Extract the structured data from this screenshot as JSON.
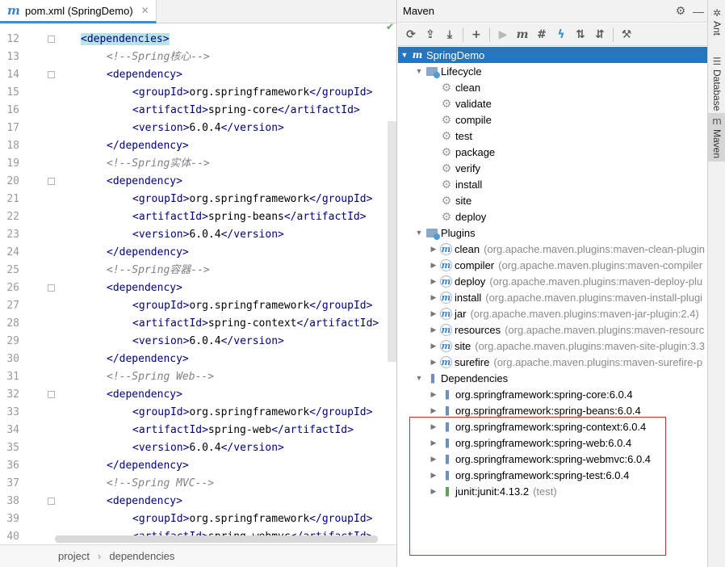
{
  "editor": {
    "tab_title": "pom.xml (SpringDemo)",
    "tab_icon": "m",
    "tab_close": "✕",
    "check_mark": "✔",
    "lines": [
      {
        "n": "12",
        "indent": 1,
        "kind": "tag",
        "text": "<dependencies>",
        "highlight": true
      },
      {
        "n": "13",
        "indent": 2,
        "kind": "comment",
        "text": "<!--Spring核心-->"
      },
      {
        "n": "14",
        "indent": 2,
        "kind": "tag",
        "text": "<dependency>"
      },
      {
        "n": "15",
        "indent": 3,
        "kind": "elem",
        "tag": "groupId",
        "value": "org.springframework"
      },
      {
        "n": "16",
        "indent": 3,
        "kind": "elem",
        "tag": "artifactId",
        "value": "spring-core"
      },
      {
        "n": "17",
        "indent": 3,
        "kind": "elem",
        "tag": "version",
        "value": "6.0.4"
      },
      {
        "n": "18",
        "indent": 2,
        "kind": "tag",
        "text": "</dependency>"
      },
      {
        "n": "19",
        "indent": 2,
        "kind": "comment",
        "text": "<!--Spring实体-->"
      },
      {
        "n": "20",
        "indent": 2,
        "kind": "tag",
        "text": "<dependency>"
      },
      {
        "n": "21",
        "indent": 3,
        "kind": "elem",
        "tag": "groupId",
        "value": "org.springframework"
      },
      {
        "n": "22",
        "indent": 3,
        "kind": "elem",
        "tag": "artifactId",
        "value": "spring-beans"
      },
      {
        "n": "23",
        "indent": 3,
        "kind": "elem",
        "tag": "version",
        "value": "6.0.4"
      },
      {
        "n": "24",
        "indent": 2,
        "kind": "tag",
        "text": "</dependency>"
      },
      {
        "n": "25",
        "indent": 2,
        "kind": "comment",
        "text": "<!--Spring容器-->"
      },
      {
        "n": "26",
        "indent": 2,
        "kind": "tag",
        "text": "<dependency>"
      },
      {
        "n": "27",
        "indent": 3,
        "kind": "elem",
        "tag": "groupId",
        "value": "org.springframework"
      },
      {
        "n": "28",
        "indent": 3,
        "kind": "elem",
        "tag": "artifactId",
        "value": "spring-context"
      },
      {
        "n": "29",
        "indent": 3,
        "kind": "elem",
        "tag": "version",
        "value": "6.0.4"
      },
      {
        "n": "30",
        "indent": 2,
        "kind": "tag",
        "text": "</dependency>"
      },
      {
        "n": "31",
        "indent": 2,
        "kind": "comment",
        "text": "<!--Spring Web-->"
      },
      {
        "n": "32",
        "indent": 2,
        "kind": "tag",
        "text": "<dependency>"
      },
      {
        "n": "33",
        "indent": 3,
        "kind": "elem",
        "tag": "groupId",
        "value": "org.springframework"
      },
      {
        "n": "34",
        "indent": 3,
        "kind": "elem",
        "tag": "artifactId",
        "value": "spring-web"
      },
      {
        "n": "35",
        "indent": 3,
        "kind": "elem",
        "tag": "version",
        "value": "6.0.4"
      },
      {
        "n": "36",
        "indent": 2,
        "kind": "tag",
        "text": "</dependency>"
      },
      {
        "n": "37",
        "indent": 2,
        "kind": "comment",
        "text": "<!--Spring MVC-->"
      },
      {
        "n": "38",
        "indent": 2,
        "kind": "tag",
        "text": "<dependency>"
      },
      {
        "n": "39",
        "indent": 3,
        "kind": "elem",
        "tag": "groupId",
        "value": "org.springframework"
      },
      {
        "n": "40",
        "indent": 3,
        "kind": "elem",
        "tag": "artifactId",
        "value": "spring-webmvc"
      }
    ],
    "breadcrumb": [
      "project",
      "dependencies"
    ],
    "breadcrumb_sep": "›"
  },
  "maven": {
    "title": "Maven",
    "header_icons": [
      "gear-icon",
      "minimize-icon"
    ],
    "header_glyphs": [
      "⚙",
      "—"
    ],
    "toolbar": [
      {
        "name": "reload-icon",
        "glyph": "⟳"
      },
      {
        "name": "reimport-folder-icon",
        "glyph": "⇪"
      },
      {
        "name": "download-icon",
        "glyph": "⤓"
      },
      {
        "name": "sep"
      },
      {
        "name": "add-icon",
        "glyph": "+"
      },
      {
        "name": "sep"
      },
      {
        "name": "run-icon",
        "glyph": "▶",
        "disabled": true
      },
      {
        "name": "maven-goal-icon",
        "glyph": "m",
        "m": true
      },
      {
        "name": "toggle-offline-icon",
        "glyph": "#"
      },
      {
        "name": "skip-tests-icon",
        "glyph": "ϟ",
        "blue": true
      },
      {
        "name": "show-dependencies-icon",
        "glyph": "⇅"
      },
      {
        "name": "collapse-all-icon",
        "glyph": "⇵"
      },
      {
        "name": "sep"
      },
      {
        "name": "settings-wrench-icon",
        "glyph": "⚒"
      }
    ],
    "tree": [
      {
        "level": 0,
        "arrow": "▼",
        "icon": "project",
        "label": "SpringDemo",
        "selected": true
      },
      {
        "level": 1,
        "arrow": "▼",
        "icon": "folder",
        "label": "Lifecycle"
      },
      {
        "level": 2,
        "arrow": "",
        "icon": "gear",
        "label": "clean"
      },
      {
        "level": 2,
        "arrow": "",
        "icon": "gear",
        "label": "validate"
      },
      {
        "level": 2,
        "arrow": "",
        "icon": "gear",
        "label": "compile"
      },
      {
        "level": 2,
        "arrow": "",
        "icon": "gear",
        "label": "test"
      },
      {
        "level": 2,
        "arrow": "",
        "icon": "gear",
        "label": "package"
      },
      {
        "level": 2,
        "arrow": "",
        "icon": "gear",
        "label": "verify"
      },
      {
        "level": 2,
        "arrow": "",
        "icon": "gear",
        "label": "install"
      },
      {
        "level": 2,
        "arrow": "",
        "icon": "gear",
        "label": "site"
      },
      {
        "level": 2,
        "arrow": "",
        "icon": "gear",
        "label": "deploy"
      },
      {
        "level": 1,
        "arrow": "▼",
        "icon": "folder",
        "label": "Plugins"
      },
      {
        "level": 2,
        "arrow": "▶",
        "icon": "plugin",
        "label": "clean",
        "detail": "(org.apache.maven.plugins:maven-clean-plugin"
      },
      {
        "level": 2,
        "arrow": "▶",
        "icon": "plugin",
        "label": "compiler",
        "detail": "(org.apache.maven.plugins:maven-compiler"
      },
      {
        "level": 2,
        "arrow": "▶",
        "icon": "plugin",
        "label": "deploy",
        "detail": "(org.apache.maven.plugins:maven-deploy-plu"
      },
      {
        "level": 2,
        "arrow": "▶",
        "icon": "plugin",
        "label": "install",
        "detail": "(org.apache.maven.plugins:maven-install-plugi"
      },
      {
        "level": 2,
        "arrow": "▶",
        "icon": "plugin",
        "label": "jar",
        "detail": "(org.apache.maven.plugins:maven-jar-plugin:2.4)"
      },
      {
        "level": 2,
        "arrow": "▶",
        "icon": "plugin",
        "label": "resources",
        "detail": "(org.apache.maven.plugins:maven-resourc"
      },
      {
        "level": 2,
        "arrow": "▶",
        "icon": "plugin",
        "label": "site",
        "detail": "(org.apache.maven.plugins:maven-site-plugin:3.3"
      },
      {
        "level": 2,
        "arrow": "▶",
        "icon": "plugin",
        "label": "surefire",
        "detail": "(org.apache.maven.plugins:maven-surefire-p"
      },
      {
        "level": 1,
        "arrow": "▼",
        "icon": "lib",
        "label": "Dependencies"
      },
      {
        "level": 2,
        "arrow": "▶",
        "icon": "lib",
        "label": "org.springframework:spring-core:6.0.4"
      },
      {
        "level": 2,
        "arrow": "▶",
        "icon": "lib",
        "label": "org.springframework:spring-beans:6.0.4"
      },
      {
        "level": 2,
        "arrow": "▶",
        "icon": "lib",
        "label": "org.springframework:spring-context:6.0.4"
      },
      {
        "level": 2,
        "arrow": "▶",
        "icon": "lib",
        "label": "org.springframework:spring-web:6.0.4"
      },
      {
        "level": 2,
        "arrow": "▶",
        "icon": "lib",
        "label": "org.springframework:spring-webmvc:6.0.4"
      },
      {
        "level": 2,
        "arrow": "▶",
        "icon": "lib",
        "label": "org.springframework:spring-test:6.0.4"
      },
      {
        "level": 2,
        "arrow": "▶",
        "icon": "lib-green",
        "label": "junit:junit:4.13.2",
        "detail": "(test)"
      }
    ]
  },
  "side_strip": [
    {
      "label": "Ant",
      "icon": "ant-icon",
      "glyph": "✲"
    },
    {
      "label": "Database",
      "icon": "database-icon",
      "glyph": "☰"
    },
    {
      "label": "Maven",
      "icon": "maven-icon",
      "glyph": "m",
      "active": true
    }
  ],
  "colors": {
    "tag": "#000080",
    "comment": "#808080",
    "selection": "#2675bf",
    "highlight_box": "#d82a2a",
    "tab_underline": "#4a88c7"
  }
}
